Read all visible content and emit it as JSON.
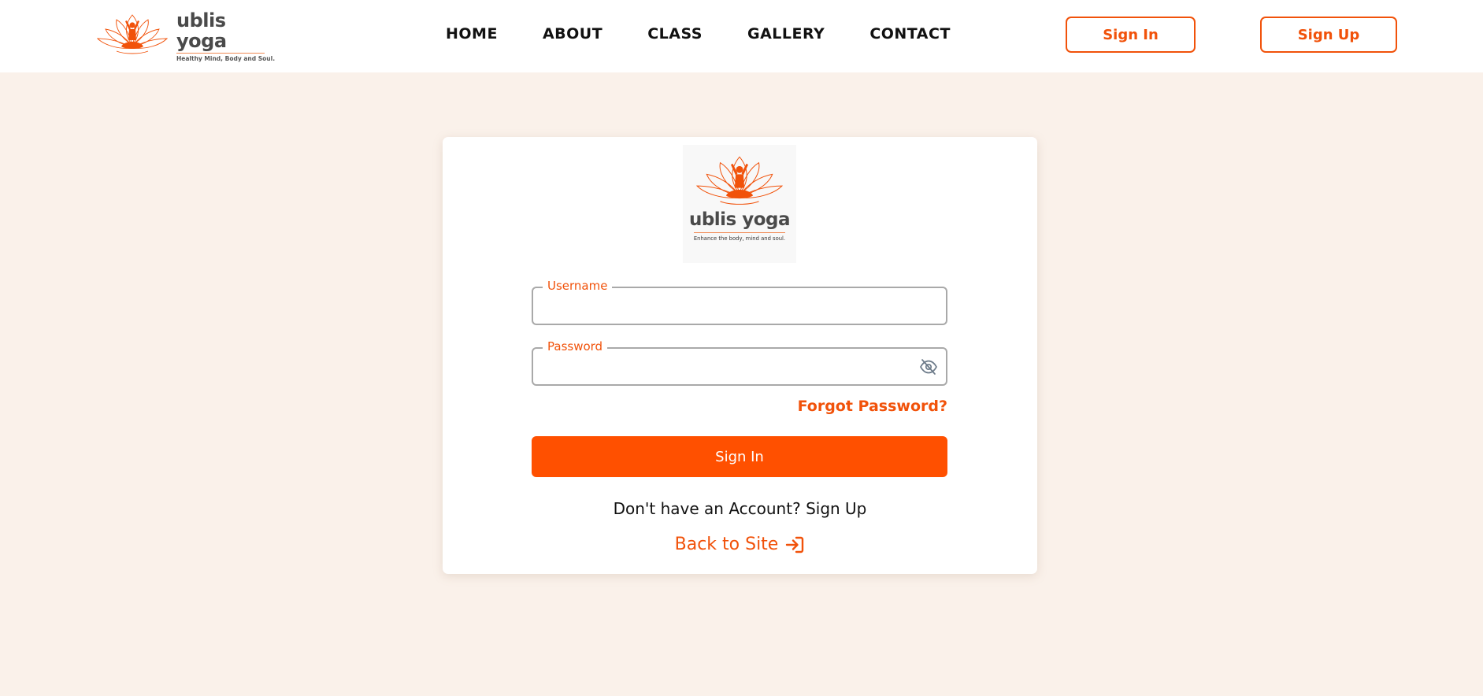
{
  "brand": {
    "name": "ublis yoga",
    "tagline": "Healthy Mind, Body and Soul."
  },
  "nav": {
    "items": [
      {
        "label": "HOME"
      },
      {
        "label": "ABOUT"
      },
      {
        "label": "CLASS"
      },
      {
        "label": "GALLERY"
      },
      {
        "label": "CONTACT"
      }
    ]
  },
  "header_buttons": {
    "sign_in": "Sign In",
    "sign_up": "Sign Up"
  },
  "login_card": {
    "logo": {
      "name": "ublis yoga",
      "tagline": "Enhance the body, mind and soul."
    },
    "username": {
      "label": "Username",
      "value": ""
    },
    "password": {
      "label": "Password",
      "value": "",
      "toggle_icon": "eye-off-icon"
    },
    "forgot_password": "Forgot Password?",
    "submit_label": "Sign In",
    "account_prompt": "Don't have an Account?",
    "sign_up_link": "Sign Up",
    "back_to_site": "Back to Site",
    "back_icon": "sign-in-arrow-icon"
  },
  "colors": {
    "accent": "#f1520a",
    "button": "#ff5000",
    "page_background": "#faf1ea",
    "header_background": "#ffffff"
  }
}
